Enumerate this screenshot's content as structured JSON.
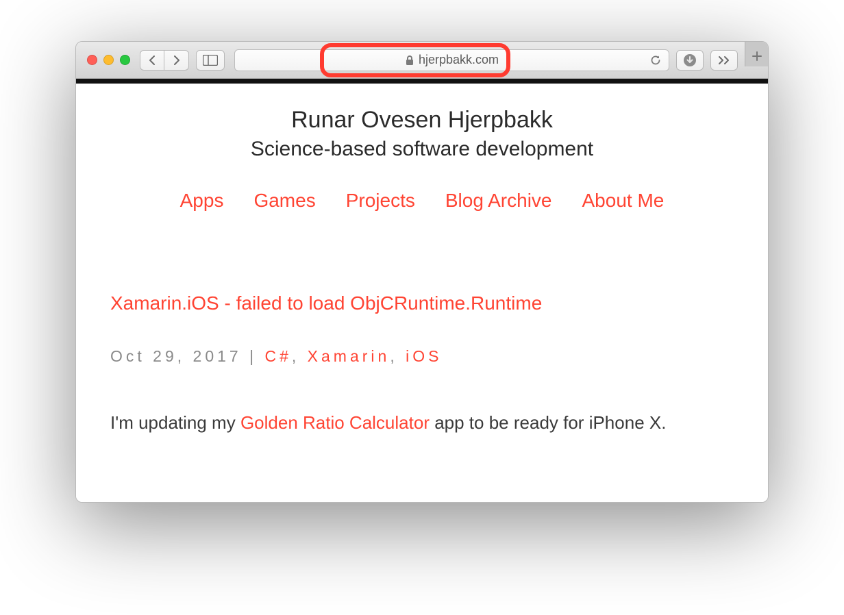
{
  "toolbar": {
    "address_text": "hjerpbakk.com"
  },
  "site": {
    "title": "Runar Ovesen Hjerpbakk",
    "subtitle": "Science-based software development",
    "nav": [
      "Apps",
      "Games",
      "Projects",
      "Blog Archive",
      "About Me"
    ]
  },
  "post": {
    "title": "Xamarin.iOS - failed to load ObjCRuntime.Runtime",
    "date": "Oct 29, 2017",
    "separator": " | ",
    "tags": [
      "C#",
      "Xamarin",
      "iOS"
    ],
    "tag_comma": ", ",
    "body_pre": "I'm updating my ",
    "body_link": "Golden Ratio Calculator",
    "body_post": " app to be ready for iPhone X."
  }
}
